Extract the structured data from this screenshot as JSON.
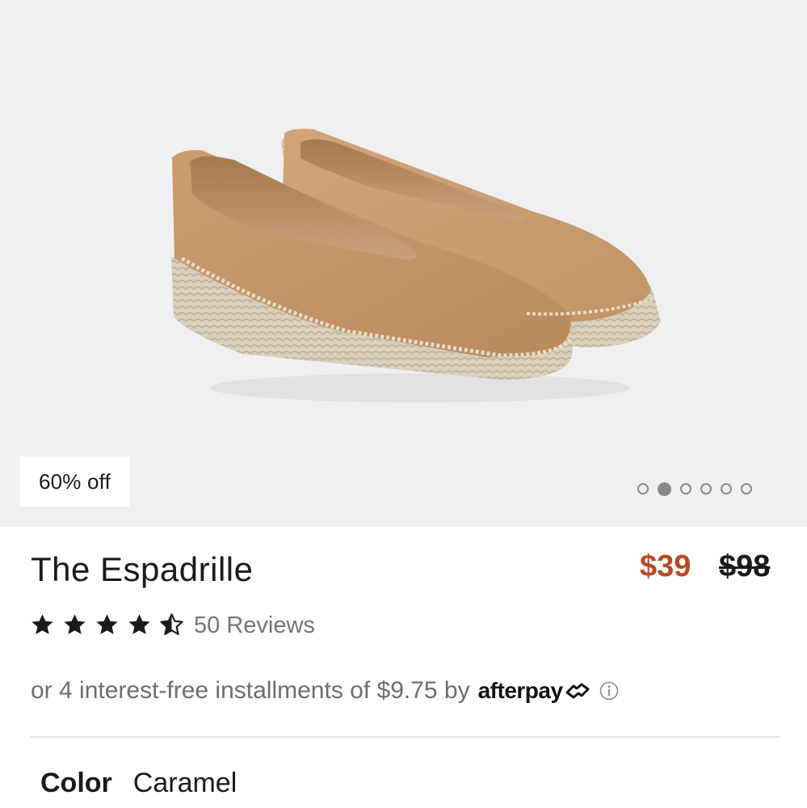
{
  "gallery": {
    "badge": "60% off",
    "image_alt": "The Espadrille in Caramel",
    "dots": [
      {
        "active": false
      },
      {
        "active": true
      },
      {
        "active": false
      },
      {
        "active": false
      },
      {
        "active": false
      },
      {
        "active": false
      }
    ]
  },
  "product": {
    "name": "The Espadrille",
    "price_sale": "$39",
    "price_original": "$98",
    "rating": 4.5,
    "reviews_label": "50 Reviews"
  },
  "installments": {
    "text": "or 4 interest-free installments of $9.75 by",
    "provider": "afterpay"
  },
  "color": {
    "label": "Color",
    "value": "Caramel"
  },
  "colors": {
    "sale_price": "#b64a26",
    "text": "#1a1a1a",
    "muted": "#757575",
    "gallery_bg": "#f0f0f0",
    "leather": "#c8996b"
  }
}
